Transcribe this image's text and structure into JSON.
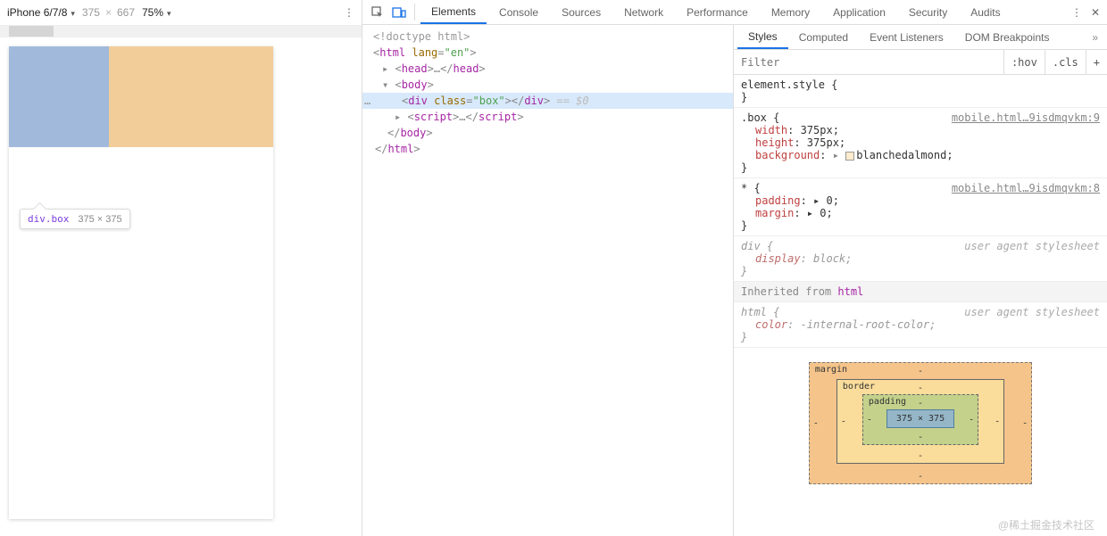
{
  "deviceBar": {
    "device": "iPhone 6/7/8",
    "w": "375",
    "h": "667",
    "zoom": "75%",
    "x": "×"
  },
  "hover": {
    "selector": "div.box",
    "size": "375 × 375"
  },
  "tabs": {
    "items": [
      "Elements",
      "Console",
      "Sources",
      "Network",
      "Performance",
      "Memory",
      "Application",
      "Security",
      "Audits"
    ],
    "active": 0
  },
  "dom": {
    "l0": "<!doctype html>",
    "l1_open": "<",
    "l1_tag": "html",
    "l1_attr": " lang",
    "l1_eq": "=",
    "l1_val": "\"en\"",
    "l1_close": ">",
    "l2_open": "<",
    "l2_tag": "head",
    "l2_close": ">",
    "l2_dots": "…",
    "l2_end": "</head>",
    "l3_open": "<",
    "l3_tag": "body",
    "l3_close": ">",
    "l4_open": "<",
    "l4_tag": "div",
    "l4_attr": " class",
    "l4_eq": "=",
    "l4_val": "\"box\"",
    "l4_close": ">",
    "l4_end": "</div>",
    "l4_eq0": " == $0",
    "l5_open": "<",
    "l5_tag": "script",
    "l5_close": ">",
    "l5_dots": "…",
    "l5_end": "</scr",
    "l5_end2": "ipt>",
    "l6": "</body>",
    "l7": "</html>",
    "ellipsis": "…"
  },
  "subtabs": {
    "items": [
      "Styles",
      "Computed",
      "Event Listeners",
      "DOM Breakpoints"
    ],
    "active": 0
  },
  "filter": {
    "placeholder": "Filter",
    "hov": ":hov",
    "cls": ".cls",
    "plus": "+"
  },
  "rules": {
    "r0": {
      "sel": "element.style {",
      "close": "}"
    },
    "r1": {
      "sel": ".box {",
      "src": "mobile.html…9isdmqvkm:9",
      "p0k": "width",
      "p0v": ": 375px;",
      "p1k": "height",
      "p1v": ": 375px;",
      "p2k": "background",
      "p2v": ":",
      "p2sw": "blanchedalmond;",
      "close": "}"
    },
    "r2": {
      "sel": "* {",
      "src": "mobile.html…9isdmqvkm:8",
      "p0k": "padding",
      "p0v": ": ▸ 0;",
      "p1k": "margin",
      "p1v": ": ▸ 0;",
      "close": "}"
    },
    "r3": {
      "sel": "div {",
      "ua": "user agent stylesheet",
      "p0k": "display",
      "p0v": ": block;",
      "close": "}"
    },
    "inh": {
      "label": "Inherited from ",
      "from": "html"
    },
    "r4": {
      "sel": "html {",
      "ua": "user agent stylesheet",
      "p0k": "color",
      "p0v": ": -internal-root-color;",
      "close": "}"
    }
  },
  "boxmodel": {
    "margin": "margin",
    "border": "border",
    "padding": "padding",
    "dash": "-",
    "content": "375 × 375"
  },
  "watermark": "@稀土掘金技术社区"
}
